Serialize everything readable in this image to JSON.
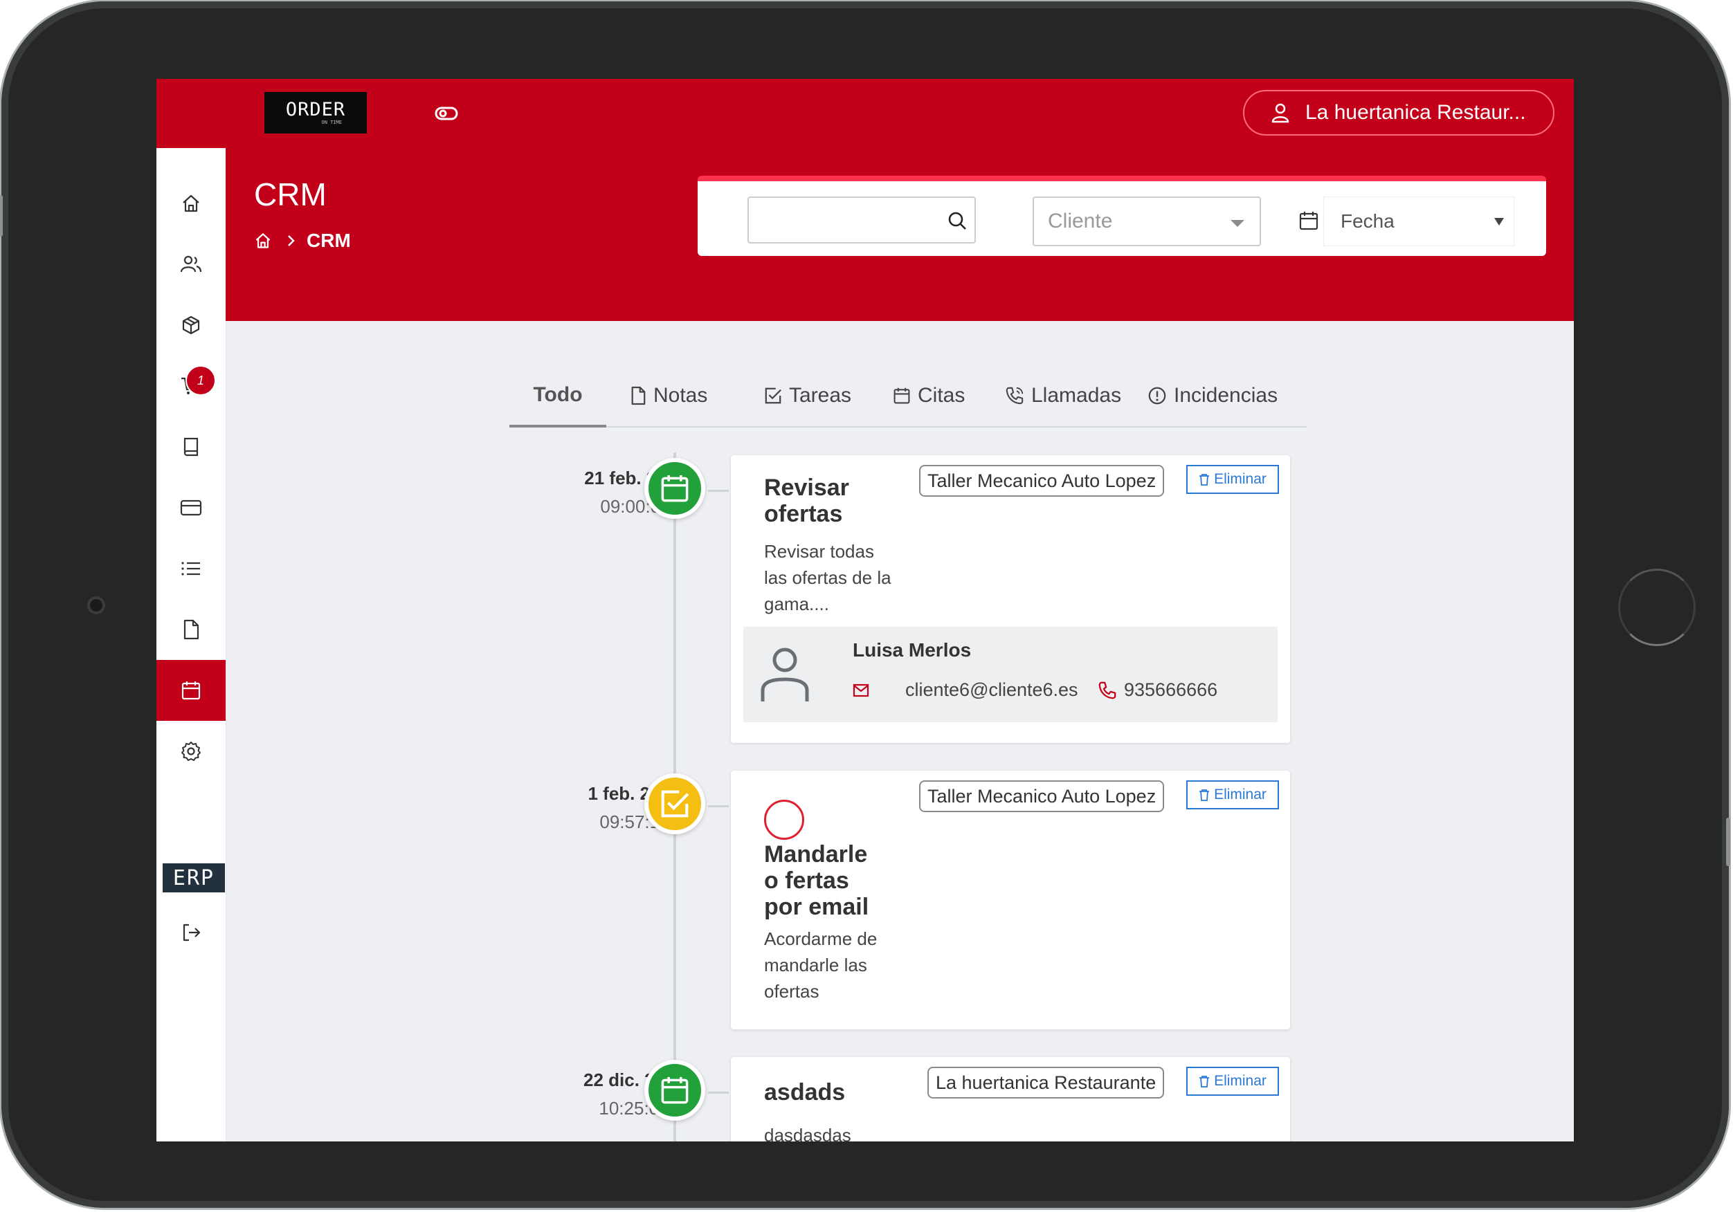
{
  "app": {
    "logo_text": "ORDER",
    "logo_sub": "ON TIME",
    "account_label": "La huertanica Restaur..."
  },
  "sidebar": {
    "cart_badge": "1",
    "erp_label": "ERP"
  },
  "header": {
    "title": "CRM",
    "breadcrumb_current": "CRM"
  },
  "filters": {
    "search_value": "",
    "cliente_placeholder": "Cliente",
    "fecha_label": "Fecha"
  },
  "tabs": [
    {
      "label": "Todo"
    },
    {
      "label": "Notas"
    },
    {
      "label": "Tareas"
    },
    {
      "label": "Citas"
    },
    {
      "label": "Llamadas"
    },
    {
      "label": "Incidencias"
    }
  ],
  "timeline": [
    {
      "date": "21 feb. 2019",
      "time": "09:00:00",
      "type_icon": "calendar-icon",
      "title": "Revisar ofertas",
      "description": "Revisar todas las ofertas de la gama....",
      "client_tag": "Taller Mecanico Auto Lopez",
      "delete_label": "Eliminar",
      "contact": {
        "name": "Luisa Merlos",
        "email": "cliente6@cliente6.es",
        "phone": "935666666"
      }
    },
    {
      "date": "1 feb. 2019",
      "time": "09:57:11",
      "type_icon": "task-check-icon",
      "title": "Mandarle o fertas por email",
      "description": "Acordarme de mandarle las ofertas",
      "client_tag": "Taller Mecanico Auto Lopez",
      "delete_label": "Eliminar"
    },
    {
      "date": "22 dic. 2018",
      "time": "10:25:00",
      "type_icon": "calendar-icon",
      "title": "asdads",
      "description": "dasdasdas",
      "client_tag": "La huertanica Restaurante",
      "delete_label": "Eliminar"
    }
  ],
  "colors": {
    "brand_red": "#c3001a",
    "accent_blue": "#2a79d8",
    "green": "#22a03a",
    "yellow": "#f4bf12"
  }
}
